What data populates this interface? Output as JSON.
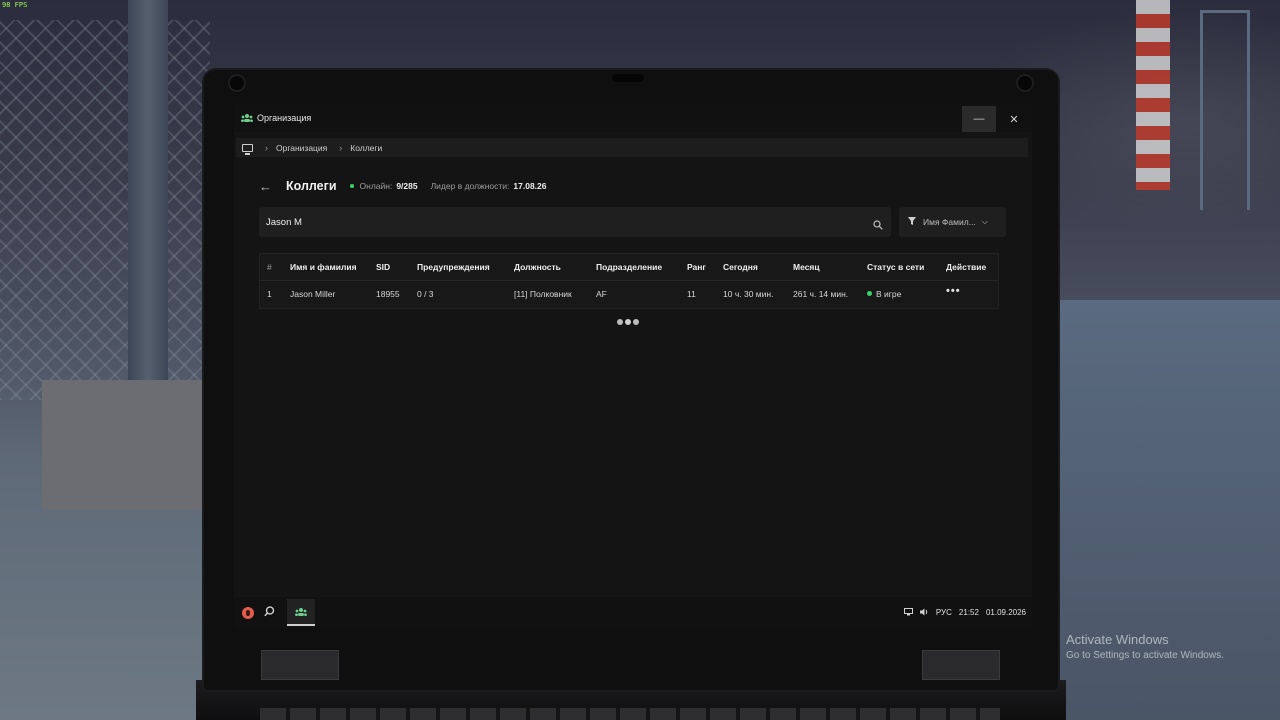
{
  "fps": "98 FPS",
  "window": {
    "title": "Организация",
    "minimize": "—",
    "close": "✕"
  },
  "breadcrumb": [
    "Организация",
    "Коллеги"
  ],
  "header": {
    "title": "Коллеги",
    "online_label": "Онлайн:",
    "online_value": "9/285",
    "leader_label": "Лидер в должности:",
    "leader_value": "17.08.26"
  },
  "search": {
    "value": "Jason M",
    "placeholder": ""
  },
  "filter": {
    "label": "Имя Фамил..."
  },
  "table": {
    "columns": [
      "#",
      "Имя и фамилия",
      "SID",
      "Предупреждения",
      "Должность",
      "Подразделение",
      "Ранг",
      "Сегодня",
      "Месяц",
      "Статус в сети",
      "Действие"
    ],
    "rows": [
      {
        "num": "1",
        "name": "Jason Miller",
        "sid": "18955",
        "warnings": "0 / 3",
        "position": "[11] Полковник",
        "division": "AF",
        "rank": "11",
        "today": "10 ч. 30 мин.",
        "month": "261 ч. 14 мин.",
        "status": "В игре",
        "action": "•••"
      }
    ]
  },
  "taskbar": {
    "lang": "РУС",
    "time": "21:52",
    "date": "01.09.2026"
  },
  "activation": {
    "title": "Activate Windows",
    "subtitle": "Go to Settings to activate Windows."
  },
  "colors": {
    "accent_green": "#3ecf67",
    "screen_bg": "#141414"
  }
}
